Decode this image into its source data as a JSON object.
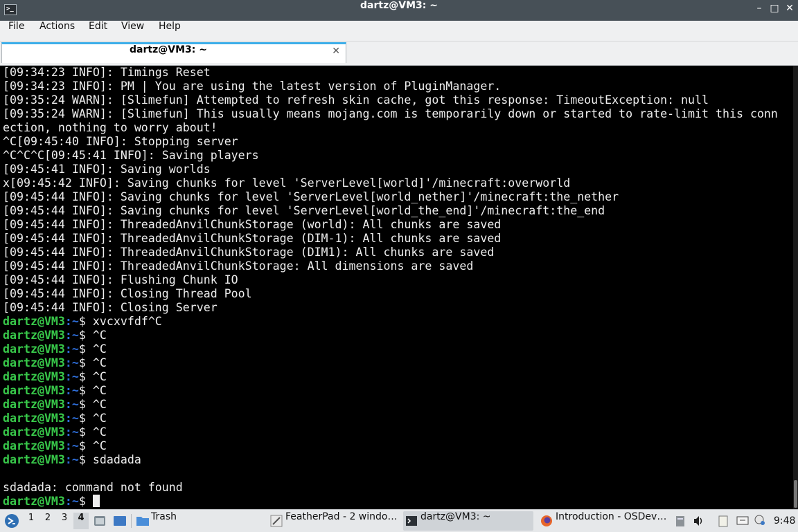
{
  "window": {
    "title": "dartz@VM3: ~",
    "app_icon": ">_",
    "controls": {
      "minimize": "–",
      "maximize": "□",
      "close": "✕"
    }
  },
  "menu": [
    "File",
    "Actions",
    "Edit",
    "View",
    "Help"
  ],
  "tab": {
    "label": "dartz@VM3: ~",
    "close": "✕"
  },
  "terminal": {
    "prompt_user": "dartz@VM3",
    "prompt_path": ":~",
    "prompt_symbol": "$ ",
    "lines": [
      {
        "text": "[09:34:23 INFO]: Timings Reset"
      },
      {
        "text": "[09:34:23 INFO]: PM | You are using the latest version of PluginManager."
      },
      {
        "text": "[09:35:24 WARN]: [Slimefun] Attempted to refresh skin cache, got this response: TimeoutException: null"
      },
      {
        "text": "[09:35:24 WARN]: [Slimefun] This usually means mojang.com is temporarily down or started to rate-limit this conn"
      },
      {
        "text": "ection, nothing to worry about!"
      },
      {
        "text": "^C[09:45:40 INFO]: Stopping server"
      },
      {
        "text": "^C^C^C[09:45:41 INFO]: Saving players"
      },
      {
        "text": "[09:45:41 INFO]: Saving worlds"
      },
      {
        "text": "x[09:45:42 INFO]: Saving chunks for level 'ServerLevel[world]'/minecraft:overworld"
      },
      {
        "text": "[09:45:44 INFO]: Saving chunks for level 'ServerLevel[world_nether]'/minecraft:the_nether"
      },
      {
        "text": "[09:45:44 INFO]: Saving chunks for level 'ServerLevel[world_the_end]'/minecraft:the_end"
      },
      {
        "text": "[09:45:44 INFO]: ThreadedAnvilChunkStorage (world): All chunks are saved"
      },
      {
        "text": "[09:45:44 INFO]: ThreadedAnvilChunkStorage (DIM-1): All chunks are saved"
      },
      {
        "text": "[09:45:44 INFO]: ThreadedAnvilChunkStorage (DIM1): All chunks are saved"
      },
      {
        "text": "[09:45:44 INFO]: ThreadedAnvilChunkStorage: All dimensions are saved"
      },
      {
        "text": "[09:45:44 INFO]: Flushing Chunk IO"
      },
      {
        "text": "[09:45:44 INFO]: Closing Thread Pool"
      },
      {
        "text": "[09:45:44 INFO]: Closing Server"
      },
      {
        "prompt": true,
        "text": "xvcxvfdf^C"
      },
      {
        "prompt": true,
        "text": "^C"
      },
      {
        "prompt": true,
        "text": "^C"
      },
      {
        "prompt": true,
        "text": "^C"
      },
      {
        "prompt": true,
        "text": "^C"
      },
      {
        "prompt": true,
        "text": "^C"
      },
      {
        "prompt": true,
        "text": "^C"
      },
      {
        "prompt": true,
        "text": "^C"
      },
      {
        "prompt": true,
        "text": "^C"
      },
      {
        "prompt": true,
        "text": "^C"
      },
      {
        "prompt": true,
        "text": "sdadada"
      },
      {
        "text": ""
      },
      {
        "text": "sdadada: command not found"
      },
      {
        "prompt": true,
        "text": "",
        "cursor": true
      }
    ]
  },
  "taskbar": {
    "workspaces": [
      "1",
      "2",
      "3",
      "4"
    ],
    "active_workspace": "4",
    "tasks": [
      {
        "label": "Trash",
        "icon": "folder-icon"
      },
      {
        "label": "FeatherPad - 2 windo…",
        "icon": "featherpad-icon"
      },
      {
        "label": "dartz@VM3: ~",
        "icon": "terminal-icon"
      },
      {
        "label": "Introduction - OSDev…",
        "icon": "firefox-icon"
      }
    ],
    "clock": "9:48"
  },
  "colors": {
    "titlebar": "#475057",
    "prompt_user": "#38c84a",
    "prompt_path": "#2e6ed9",
    "accent": "#3daee9"
  }
}
